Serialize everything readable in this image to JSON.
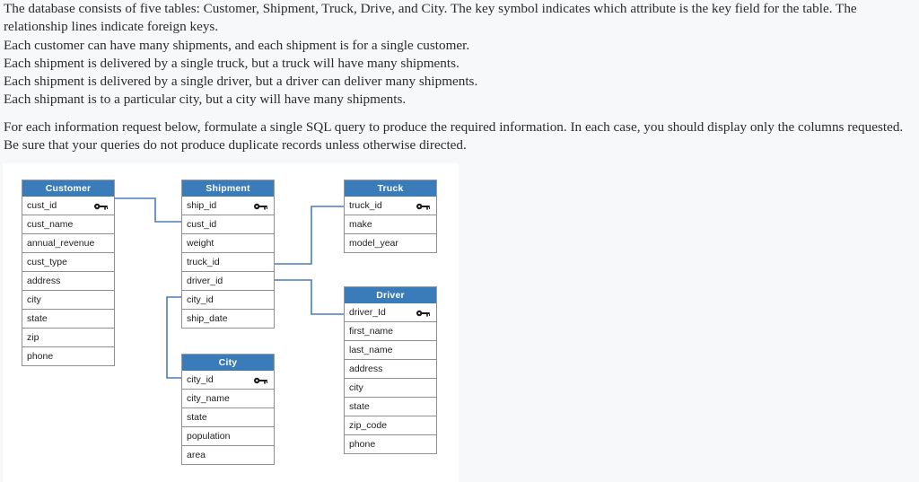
{
  "intro": {
    "lines": [
      "The database consists of five tables: Customer, Shipment, Truck, Drive, and City.  The key symbol indicates which attribute is the key field for the table.  The relationship lines indicate foreign keys.",
      "Each customer can have many shipments, and each shipment is for a single customer.",
      "Each shipment is delivered by a single truck, but a truck will have many shipments.",
      "Each shipment is delivered by a single driver, but a driver can deliver many shipments.",
      "Each shipmant is to a particular city, but a city will have many shipments."
    ],
    "paragraph2": "For each information request below, formulate a single SQL query to produce the required information.  In each case, you should display only the columns requested.  Be sure that your queries do not produce duplicate records unless otherwise directed."
  },
  "colors": {
    "header_blue": "#3a7cb9",
    "header_text": "#ffffff",
    "border_gray": "#8f8f8f",
    "connector_blue": "#4a7db5",
    "page_background": "#f7f8fa",
    "panel_background": "#ffffff"
  },
  "icons": {
    "primary_key": "key-icon"
  },
  "erd": {
    "tables": [
      {
        "name": "Customer",
        "fields": [
          {
            "label": "cust_id",
            "key": true
          },
          {
            "label": "cust_name",
            "key": false
          },
          {
            "label": "annual_revenue",
            "key": false
          },
          {
            "label": "cust_type",
            "key": false
          },
          {
            "label": "address",
            "key": false
          },
          {
            "label": "city",
            "key": false
          },
          {
            "label": "state",
            "key": false
          },
          {
            "label": "zip",
            "key": false
          },
          {
            "label": "phone",
            "key": false
          }
        ]
      },
      {
        "name": "Shipment",
        "fields": [
          {
            "label": "ship_id",
            "key": true
          },
          {
            "label": "cust_id",
            "key": false
          },
          {
            "label": "weight",
            "key": false
          },
          {
            "label": "truck_id",
            "key": false
          },
          {
            "label": "driver_id",
            "key": false
          },
          {
            "label": "city_id",
            "key": false
          },
          {
            "label": "ship_date",
            "key": false
          }
        ]
      },
      {
        "name": "Truck",
        "fields": [
          {
            "label": "truck_id",
            "key": true
          },
          {
            "label": "make",
            "key": false
          },
          {
            "label": "model_year",
            "key": false
          }
        ]
      },
      {
        "name": "Driver",
        "fields": [
          {
            "label": "driver_Id",
            "key": true
          },
          {
            "label": "first_name",
            "key": false
          },
          {
            "label": "last_name",
            "key": false
          },
          {
            "label": "address",
            "key": false
          },
          {
            "label": "city",
            "key": false
          },
          {
            "label": "state",
            "key": false
          },
          {
            "label": "zip_code",
            "key": false
          },
          {
            "label": "phone",
            "key": false
          }
        ]
      },
      {
        "name": "City",
        "fields": [
          {
            "label": "city_id",
            "key": true
          },
          {
            "label": "city_name",
            "key": false
          },
          {
            "label": "state",
            "key": false
          },
          {
            "label": "population",
            "key": false
          },
          {
            "label": "area",
            "key": false
          }
        ]
      }
    ],
    "relationships": [
      {
        "from": "Customer.cust_id",
        "to": "Shipment.cust_id"
      },
      {
        "from": "Shipment.truck_id",
        "to": "Truck.truck_id"
      },
      {
        "from": "Shipment.driver_id",
        "to": "Driver.driver_Id"
      },
      {
        "from": "Shipment.city_id",
        "to": "City.city_id"
      }
    ]
  }
}
